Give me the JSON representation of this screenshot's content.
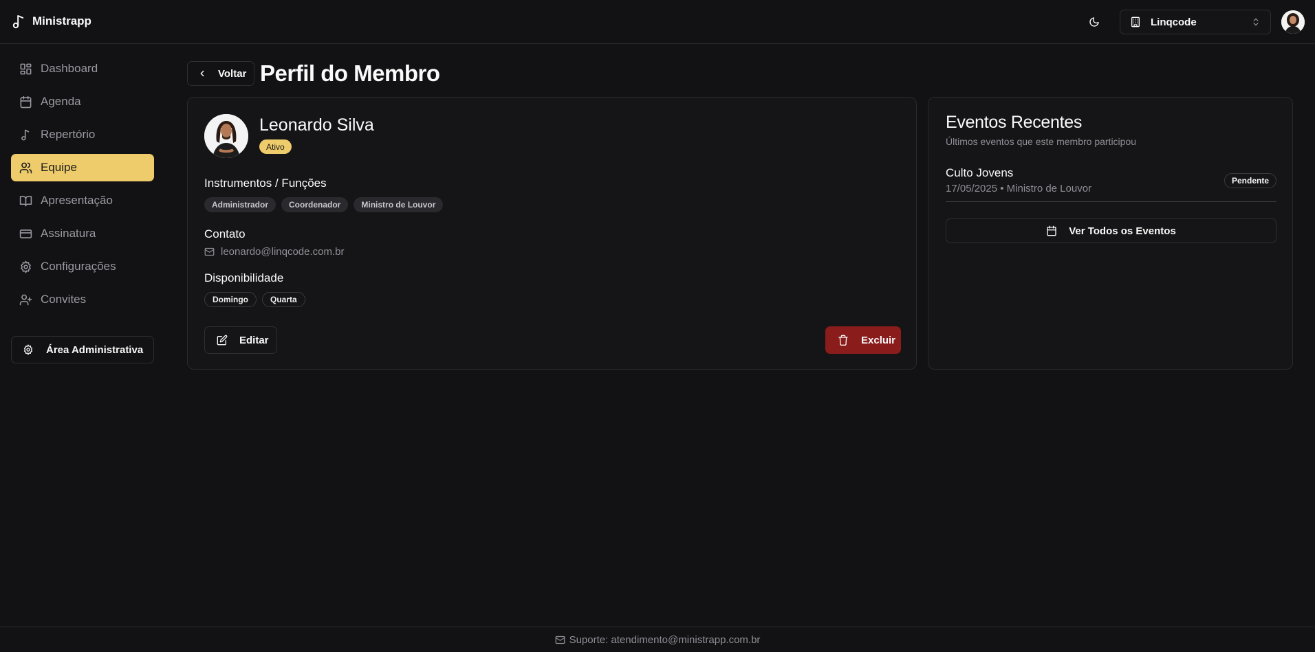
{
  "app": {
    "name": "Ministrapp"
  },
  "header": {
    "organization": "Linqcode",
    "icons": {
      "logo": "music-note-icon",
      "theme": "moon-icon",
      "org": "building-icon",
      "org_chevron": "chevron-up-down-icon"
    }
  },
  "sidebar": {
    "items": [
      {
        "label": "Dashboard",
        "icon": "dashboard-icon",
        "active": false
      },
      {
        "label": "Agenda",
        "icon": "calendar-icon",
        "active": false
      },
      {
        "label": "Repertório",
        "icon": "music-note-icon",
        "active": false
      },
      {
        "label": "Equipe",
        "icon": "users-icon",
        "active": true
      },
      {
        "label": "Apresentação",
        "icon": "book-open-icon",
        "active": false
      },
      {
        "label": "Assinatura",
        "icon": "credit-card-icon",
        "active": false
      },
      {
        "label": "Configurações",
        "icon": "gear-icon",
        "active": false
      },
      {
        "label": "Convites",
        "icon": "user-plus-icon",
        "active": false
      }
    ],
    "admin_label": "Área Administrativa"
  },
  "page": {
    "back_label": "Voltar",
    "title": "Perfil do Membro"
  },
  "profile": {
    "name": "Leonardo Silva",
    "status": "Ativo",
    "roles_title": "Instrumentos / Funções",
    "roles": [
      "Administrador",
      "Coordenador",
      "Ministro de Louvor"
    ],
    "contact_title": "Contato",
    "email": "leonardo@linqcode.com.br",
    "availability_title": "Disponibilidade",
    "availability": [
      "Domingo",
      "Quarta"
    ],
    "edit_label": "Editar",
    "delete_label": "Excluir"
  },
  "events": {
    "title": "Eventos Recentes",
    "subtitle": "Últimos eventos que este membro participou",
    "items": [
      {
        "name": "Culto Jovens",
        "meta": "17/05/2025 • Ministro de Louvor",
        "status": "Pendente"
      }
    ],
    "view_all_label": "Ver Todos os Eventos"
  },
  "footer": {
    "support": "Suporte: atendimento@ministrapp.com.br"
  },
  "colors": {
    "accent": "#eecb6b",
    "danger": "#8a1c1c",
    "background": "#121214"
  }
}
